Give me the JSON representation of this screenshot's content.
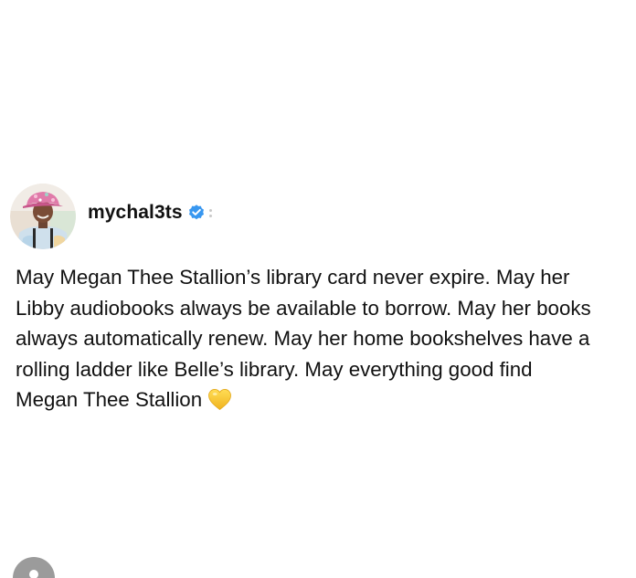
{
  "post": {
    "username": "mychal3ts",
    "verified": true,
    "avatar_icon": "profile-photo",
    "caption_lines": [
      "May Megan Thee Stallion’s library card never expire. May her",
      "Libby audiobooks always be available to borrow. May her books",
      "always automatically renew. May her home bookshelves have a",
      "rolling ladder like Belle’s library. May everything good find",
      "Megan Thee Stallion"
    ],
    "caption_emoji": "yellow-heart-icon"
  },
  "colors": {
    "verified_badge": "#3897f0",
    "text": "#111111",
    "heart": "#f6c531"
  }
}
